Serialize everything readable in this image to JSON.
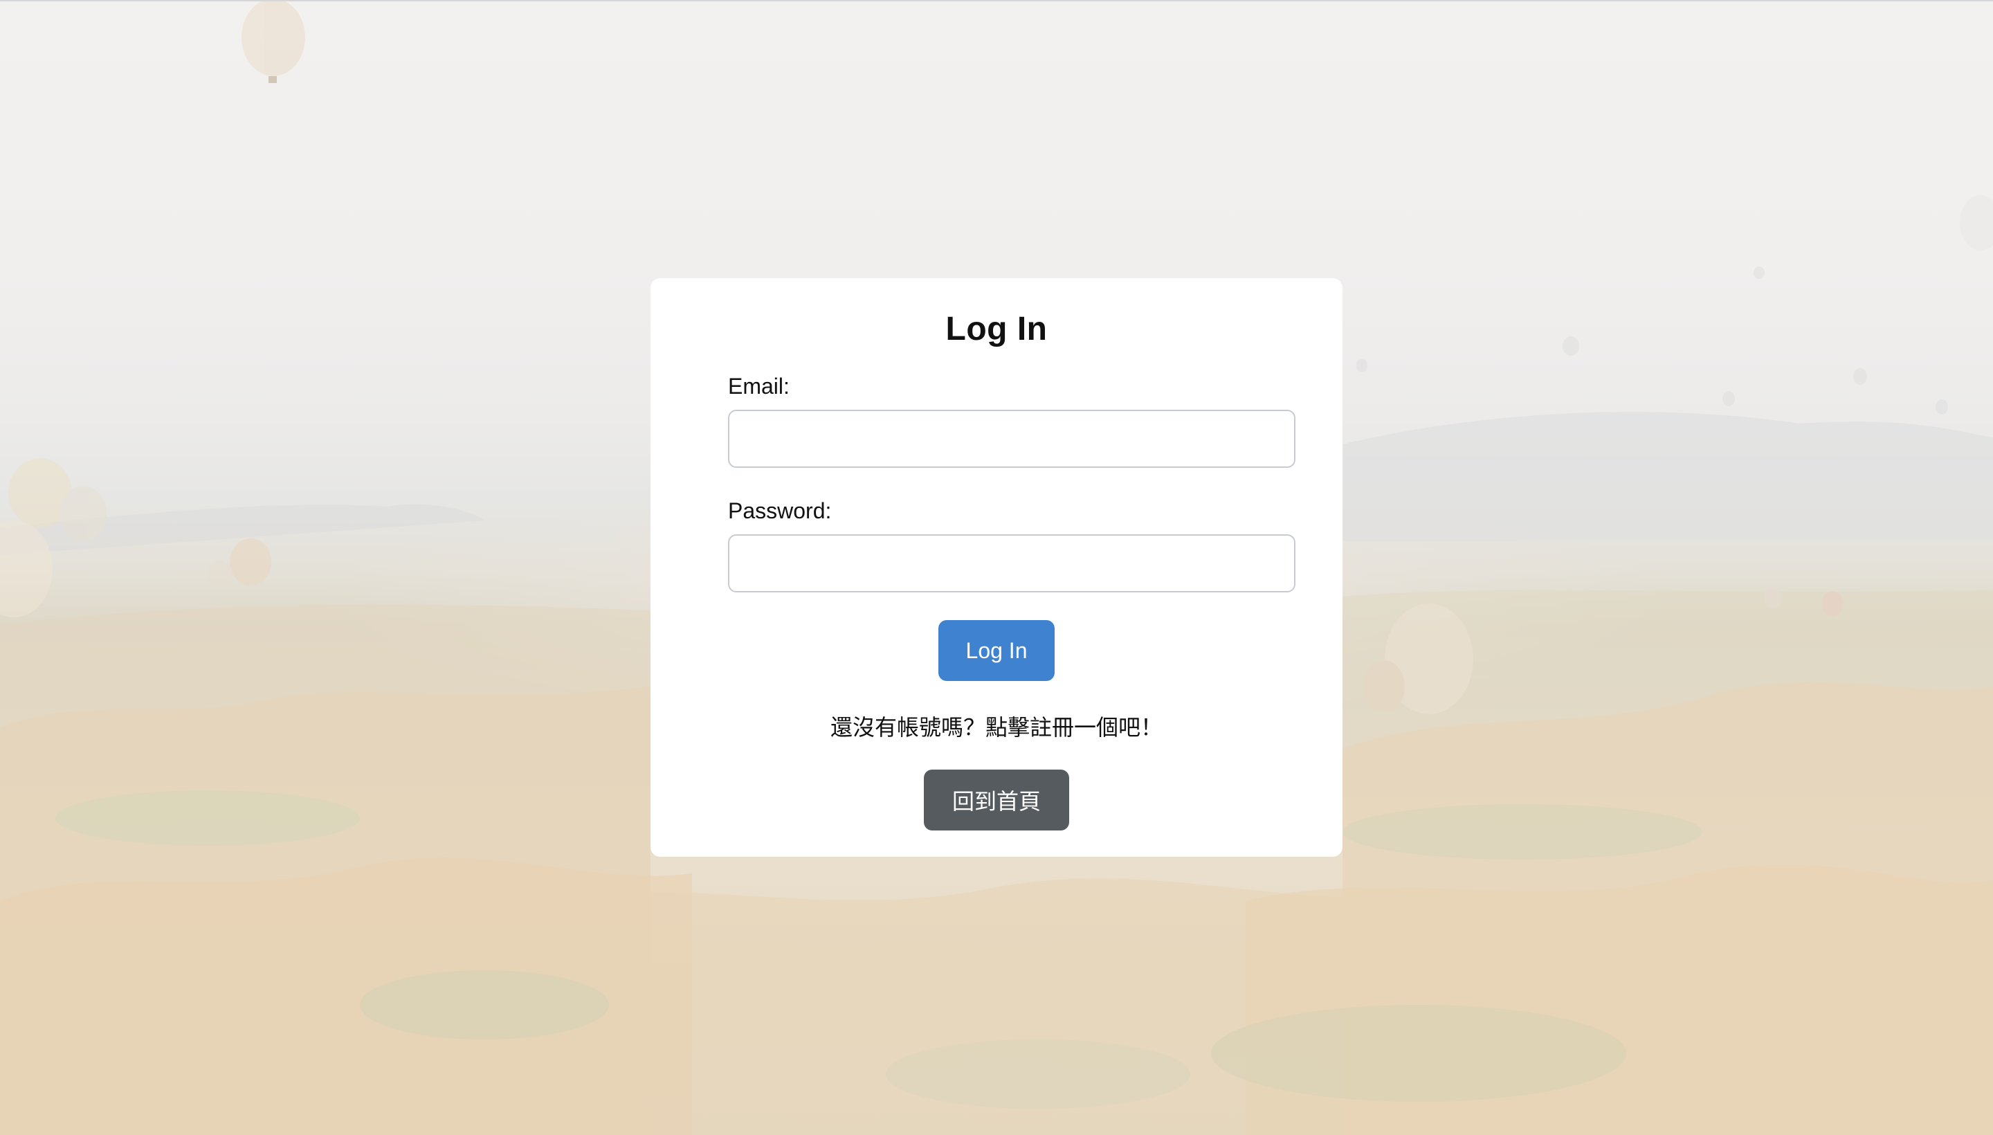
{
  "login_card": {
    "title": "Log In",
    "email_label": "Email:",
    "email_value": "",
    "password_label": "Password:",
    "password_value": "",
    "login_button_label": "Log In",
    "signup_prompt": "還沒有帳號嗎？點擊註冊一個吧！",
    "home_button_label": "回到首頁"
  },
  "colors": {
    "login_button": "#3f83d0",
    "home_button": "#565b60",
    "card_background": "#ffffff"
  }
}
